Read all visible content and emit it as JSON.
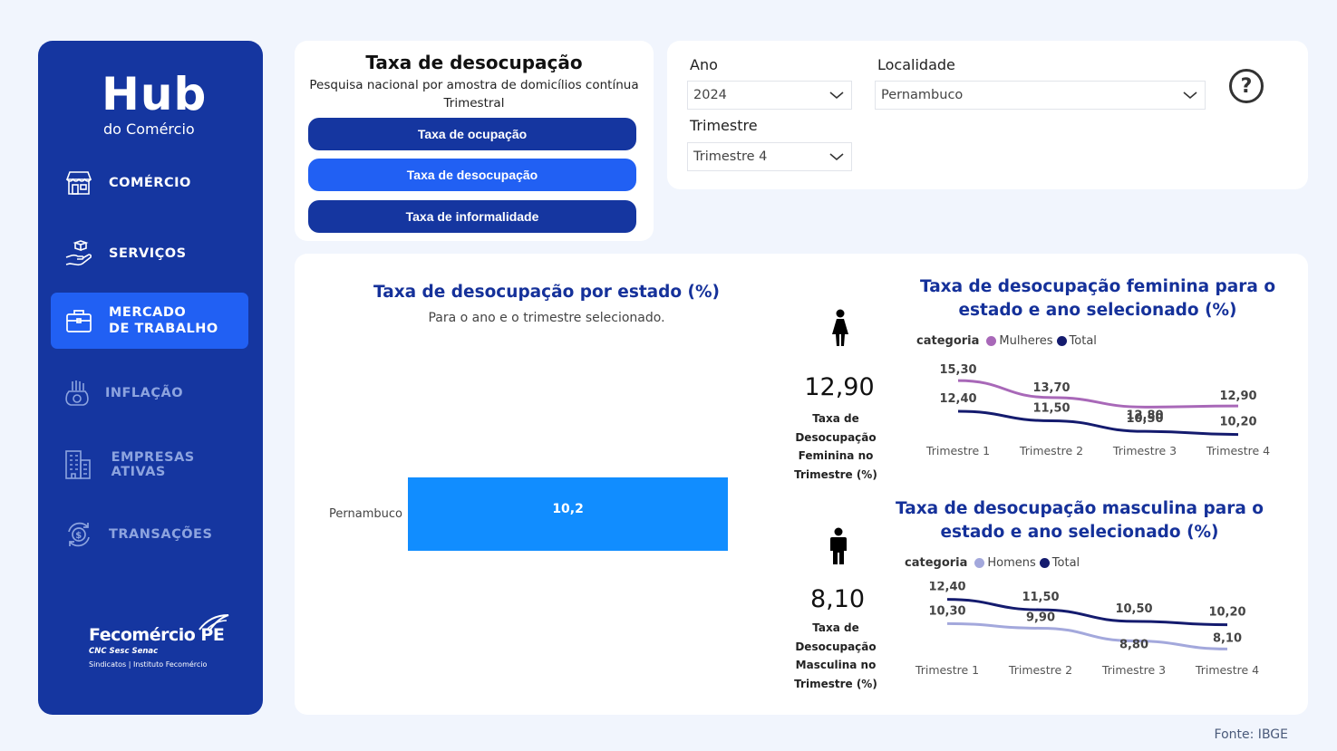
{
  "brand": {
    "title": "Hub",
    "subtitle": "do Comércio"
  },
  "nav": [
    {
      "label": "COMÉRCIO",
      "icon": "store-icon"
    },
    {
      "label": "SERVIÇOS",
      "icon": "hand-box-icon"
    },
    {
      "label_line1": "MERCADO",
      "label_line2": "DE TRABALHO",
      "icon": "briefcase-icon"
    },
    {
      "label": "INFLAÇÃO",
      "icon": "money-bag-icon"
    },
    {
      "label": "EMPRESAS ATIVAS",
      "icon": "building-icon"
    },
    {
      "label": "TRANSAÇÕES",
      "icon": "coin-cycle-icon"
    }
  ],
  "footer_logo": {
    "name": "Fecomércio PE",
    "line2": "CNC Sesc Senac",
    "line3": "Sindicatos  |  Instituto Fecomércio"
  },
  "header": {
    "title": "Taxa de desocupação",
    "subtitle": "Pesquisa nacional por amostra de domicílios contínua Trimestral",
    "buttons": [
      "Taxa de ocupação",
      "Taxa de desocupação",
      "Taxa de informalidade"
    ],
    "active_button": 1
  },
  "filters": {
    "ano_label": "Ano",
    "ano_value": "2024",
    "localidade_label": "Localidade",
    "localidade_value": "Pernambuco",
    "trimestre_label": "Trimestre",
    "trimestre_value": "Trimestre 4"
  },
  "bar_chart": {
    "title": "Taxa de desocupação por estado (%)",
    "subtitle": "Para o ano e o trimestre selecionado."
  },
  "kpi_feminina": {
    "value": "12,90",
    "label_lines": [
      "Taxa de",
      "Desocupação",
      "Feminina no",
      "Trimestre (%)"
    ]
  },
  "kpi_masculina": {
    "value": "8,10",
    "label_lines": [
      "Taxa de",
      "Desocupação",
      "Masculina no",
      "Trimestre (%)"
    ]
  },
  "fonte": "Fonte: IBGE",
  "colors": {
    "sidebar": "#1536a0",
    "accent": "#2160f3",
    "bar": "#118dff",
    "mulheres": "#a868b8",
    "homens": "#a3a8dc",
    "total": "#141b6e"
  },
  "chart_data": [
    {
      "type": "bar",
      "title": "Taxa de desocupação por estado (%)",
      "categories": [
        "Pernambuco"
      ],
      "values": [
        10.2
      ],
      "value_labels": [
        "10,2"
      ],
      "xlim": [
        0,
        16
      ]
    },
    {
      "type": "line",
      "title": "Taxa de desocupação feminina para o estado e ano selecionado (%)",
      "legend_title": "categoria",
      "categories": [
        "Trimestre 1",
        "Trimestre 2",
        "Trimestre 3",
        "Trimestre 4"
      ],
      "series": [
        {
          "name": "Mulheres",
          "values": [
            15.3,
            13.7,
            12.8,
            12.9
          ],
          "labels": [
            "15,30",
            "13,70",
            "12,80",
            "12,90"
          ]
        },
        {
          "name": "Total",
          "values": [
            12.4,
            11.5,
            10.5,
            10.2
          ],
          "labels": [
            "12,40",
            "11,50",
            "10,50",
            "10,20"
          ]
        }
      ]
    },
    {
      "type": "line",
      "title": "Taxa de desocupação masculina para o estado e ano selecionado (%)",
      "legend_title": "categoria",
      "categories": [
        "Trimestre 1",
        "Trimestre 2",
        "Trimestre 3",
        "Trimestre 4"
      ],
      "series": [
        {
          "name": "Homens",
          "values": [
            10.3,
            9.9,
            8.8,
            8.1
          ],
          "labels": [
            "10,30",
            "9,90",
            "8,80",
            "8,10"
          ]
        },
        {
          "name": "Total",
          "values": [
            12.4,
            11.5,
            10.5,
            10.2
          ],
          "labels": [
            "12,40",
            "11,50",
            "10,50",
            "10,20"
          ]
        }
      ]
    }
  ]
}
